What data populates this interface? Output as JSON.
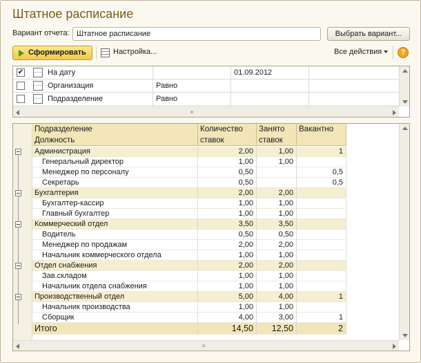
{
  "window": {
    "title": "Штатное расписание"
  },
  "variant": {
    "label": "Вариант отчета:",
    "value": "Штатное расписание",
    "choose_button": "Выбрать вариант..."
  },
  "toolbar": {
    "run_button": "Сформировать",
    "settings_label": "Настройка...",
    "all_actions": "Все действия",
    "help": "?"
  },
  "filters": [
    {
      "checked": true,
      "check_mark": "✔",
      "name": "На дату",
      "condition": "",
      "value": "01.09.2012"
    },
    {
      "checked": false,
      "check_mark": "",
      "name": "Организация",
      "condition": "Равно",
      "value": ""
    },
    {
      "checked": false,
      "check_mark": "",
      "name": "Подразделение",
      "condition": "Равно",
      "value": ""
    }
  ],
  "report": {
    "headers": {
      "col1_line1": "Подразделение",
      "col1_line2": "Должность",
      "col2_line1": "Количество",
      "col2_line2": "ставок",
      "col3_line1": "Занято",
      "col3_line2": "ставок",
      "col4_line1": "Вакантно"
    },
    "rows": [
      {
        "group": true,
        "name": "Администрация",
        "qty": "2,00",
        "busy": "1,00",
        "vac": "1"
      },
      {
        "group": false,
        "name": "Генеральный директор",
        "qty": "1,00",
        "busy": "1,00",
        "vac": ""
      },
      {
        "group": false,
        "name": "Менеджер по персоналу",
        "qty": "0,50",
        "busy": "",
        "vac": "0,5"
      },
      {
        "group": false,
        "name": "Секретарь",
        "qty": "0,50",
        "busy": "",
        "vac": "0,5"
      },
      {
        "group": true,
        "name": "Бухгалтерия",
        "qty": "2,00",
        "busy": "2,00",
        "vac": ""
      },
      {
        "group": false,
        "name": "Бухгалтер-кассир",
        "qty": "1,00",
        "busy": "1,00",
        "vac": ""
      },
      {
        "group": false,
        "name": "Главный бухгалтер",
        "qty": "1,00",
        "busy": "1,00",
        "vac": ""
      },
      {
        "group": true,
        "name": "Коммерческий отдел",
        "qty": "3,50",
        "busy": "3,50",
        "vac": ""
      },
      {
        "group": false,
        "name": "Водитель",
        "qty": "0,50",
        "busy": "0,50",
        "vac": ""
      },
      {
        "group": false,
        "name": "Менеджер по продажам",
        "qty": "2,00",
        "busy": "2,00",
        "vac": ""
      },
      {
        "group": false,
        "name": "Начальник коммерческого отдела",
        "qty": "1,00",
        "busy": "1,00",
        "vac": ""
      },
      {
        "group": true,
        "name": "Отдел снабжения",
        "qty": "2,00",
        "busy": "2,00",
        "vac": ""
      },
      {
        "group": false,
        "name": "Зав.складом",
        "qty": "1,00",
        "busy": "1,00",
        "vac": ""
      },
      {
        "group": false,
        "name": "Начальник отдела снабжения",
        "qty": "1,00",
        "busy": "1,00",
        "vac": ""
      },
      {
        "group": true,
        "name": "Производственный отдел",
        "qty": "5,00",
        "busy": "4,00",
        "vac": "1"
      },
      {
        "group": false,
        "name": "Начальник производства",
        "qty": "1,00",
        "busy": "1,00",
        "vac": ""
      },
      {
        "group": false,
        "name": "Сборщик",
        "qty": "4,00",
        "busy": "3,00",
        "vac": "1"
      }
    ],
    "total": {
      "name": "Итого",
      "qty": "14,50",
      "busy": "12,50",
      "vac": "2"
    }
  }
}
